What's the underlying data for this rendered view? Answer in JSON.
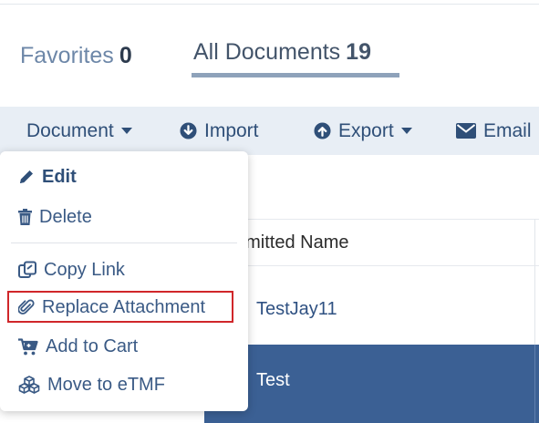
{
  "tabs": {
    "favorites": {
      "label": "Favorites",
      "count": "0"
    },
    "all_documents": {
      "label": "All Documents",
      "count": "19"
    }
  },
  "toolbar": {
    "document_label": "Document",
    "import_label": "Import",
    "export_label": "Export",
    "email_label": "Email"
  },
  "table": {
    "column_header": "bmitted Name",
    "rows": [
      {
        "name": "TestJay11"
      },
      {
        "name": "Test",
        "selected": true
      }
    ]
  },
  "document_menu": {
    "items": [
      {
        "label": "Edit",
        "icon": "pencil-icon"
      },
      {
        "label": "Delete",
        "icon": "trash-icon"
      },
      {
        "label": "Copy Link",
        "icon": "copy-link-icon"
      },
      {
        "label": "Replace Attachment",
        "icon": "paperclip-icon",
        "highlighted": true
      },
      {
        "label": "Add to Cart",
        "icon": "cart-icon"
      },
      {
        "label": "Move to eTMF",
        "icon": "cubes-icon"
      }
    ]
  },
  "colors": {
    "accent": "#3b6094",
    "toolbar_bg": "#e8eef5",
    "highlight": "#d0262a"
  }
}
